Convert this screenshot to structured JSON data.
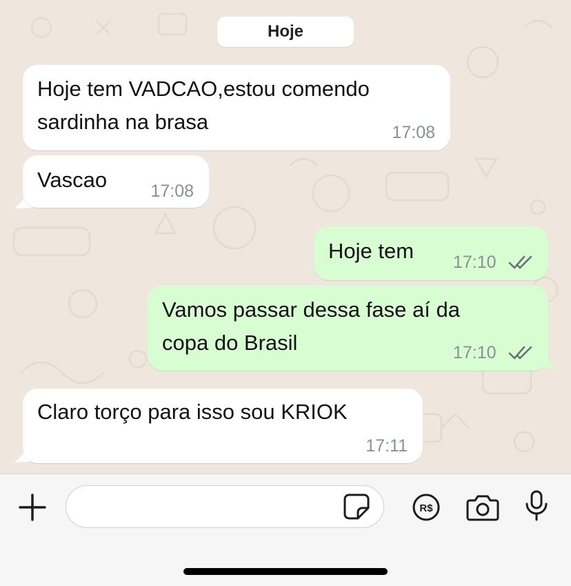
{
  "chat": {
    "date_label": "Hoje",
    "messages": [
      {
        "direction": "incoming",
        "lines": [
          "Hoje tem VADCAO,estou comendo",
          "sardinha na brasa"
        ],
        "time": "17:08"
      },
      {
        "direction": "incoming",
        "lines": [
          "Vascao"
        ],
        "time": "17:08"
      },
      {
        "direction": "outgoing",
        "lines": [
          "Hoje tem"
        ],
        "time": "17:10",
        "status": "read-ticks"
      },
      {
        "direction": "outgoing",
        "lines": [
          "Vamos passar dessa fase aí da",
          "copa do Brasil"
        ],
        "time": "17:10",
        "status": "read-ticks"
      },
      {
        "direction": "incoming",
        "lines": [
          "Claro torço para isso sou KRIOK"
        ],
        "time": "17:11"
      }
    ]
  },
  "input_bar": {
    "message_value": "",
    "icons": [
      "plus-icon",
      "sticker-icon",
      "payment-icon",
      "camera-icon",
      "microphone-icon"
    ],
    "payment_label": "R$"
  },
  "colors": {
    "chat_background": "#efe7dd",
    "incoming_bubble": "#ffffff",
    "outgoing_bubble": "#d9fdd3",
    "time_text": "#8a8f93",
    "icon": "#1c1c1e"
  }
}
